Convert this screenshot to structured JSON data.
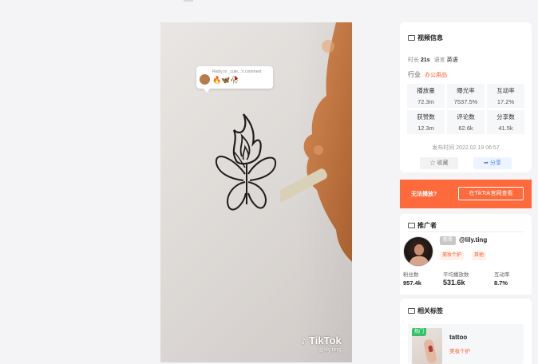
{
  "video": {
    "reply_label": "Reply to _cute...'s comment",
    "reply_emojis": "🔥🦋🥀",
    "watermark_brand": "TikTok",
    "watermark_user": "@lily.ting"
  },
  "info": {
    "title": "视频信息",
    "duration_label": "时长",
    "duration_value": "21s",
    "language_label": "语言",
    "language_value": "英语",
    "industry_label": "行业",
    "industry_value": "办公用品",
    "stats": [
      {
        "label": "播放量",
        "value": "72.3m"
      },
      {
        "label": "曝光率",
        "value": "7537.5%"
      },
      {
        "label": "互动率",
        "value": "17.2%"
      },
      {
        "label": "获赞数",
        "value": "12.3m"
      },
      {
        "label": "评论数",
        "value": "62.6k"
      },
      {
        "label": "分享数",
        "value": "41.5k"
      }
    ],
    "publish_time": "发布时间 2022.02.19 06:57",
    "collect_label": "收藏",
    "share_label": "分享"
  },
  "cant_play": {
    "text": "无法播放?",
    "button": "在TikTok官网查看"
  },
  "promoter": {
    "title": "推广者",
    "user_tag": "新晋",
    "handle": "@lily.ting",
    "pill_1": "美妆个护",
    "pill_2": "其他",
    "kpis": [
      {
        "label": "粉丝数",
        "value": "957.4k"
      },
      {
        "label": "平均播放数",
        "value": "531.6k"
      },
      {
        "label": "互动率",
        "value": "8.7%"
      }
    ]
  },
  "tags": {
    "title": "相关标签",
    "hot_badge": "热门",
    "tag_name": "tattoo",
    "tag_category": "美妆个护"
  },
  "colors": {
    "accent": "#ff6a3d",
    "link_blue": "#4a7fe8"
  }
}
